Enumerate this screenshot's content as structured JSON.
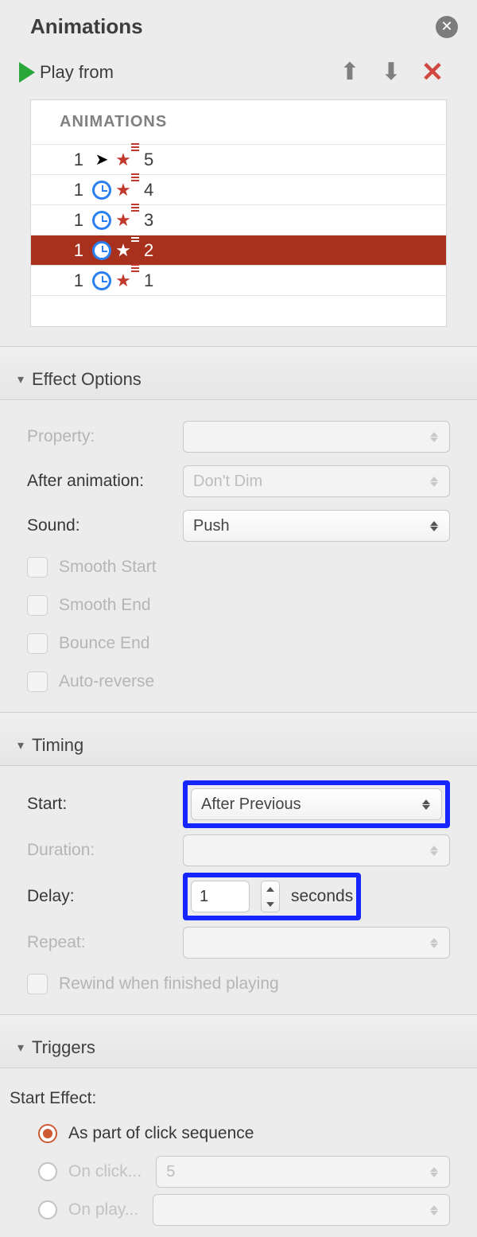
{
  "header": {
    "title": "Animations"
  },
  "toolbar": {
    "play_label": "Play from"
  },
  "anim_list": {
    "header": "ANIMATIONS",
    "rows": [
      {
        "idx": "1",
        "timing": "click",
        "label": "5",
        "selected": false
      },
      {
        "idx": "1",
        "timing": "clock",
        "label": "4",
        "selected": false
      },
      {
        "idx": "1",
        "timing": "clock",
        "label": "3",
        "selected": false
      },
      {
        "idx": "1",
        "timing": "clock",
        "label": "2",
        "selected": true
      },
      {
        "idx": "1",
        "timing": "clock",
        "label": "1",
        "selected": false
      }
    ]
  },
  "sections": {
    "effect_options": {
      "title": "Effect Options",
      "property_label": "Property:",
      "after_anim_label": "After animation:",
      "after_anim_value": "Don't Dim",
      "sound_label": "Sound:",
      "sound_value": "Push",
      "smooth_start": "Smooth Start",
      "smooth_end": "Smooth End",
      "bounce_end": "Bounce End",
      "auto_reverse": "Auto-reverse"
    },
    "timing": {
      "title": "Timing",
      "start_label": "Start:",
      "start_value": "After Previous",
      "duration_label": "Duration:",
      "delay_label": "Delay:",
      "delay_value": "1",
      "delay_unit": "seconds",
      "repeat_label": "Repeat:",
      "rewind": "Rewind when finished playing"
    },
    "triggers": {
      "title": "Triggers",
      "start_effect": "Start Effect:",
      "opt_click_seq": "As part of click sequence",
      "opt_on_click": "On click...",
      "on_click_value": "5",
      "opt_on_play": "On play..."
    }
  }
}
